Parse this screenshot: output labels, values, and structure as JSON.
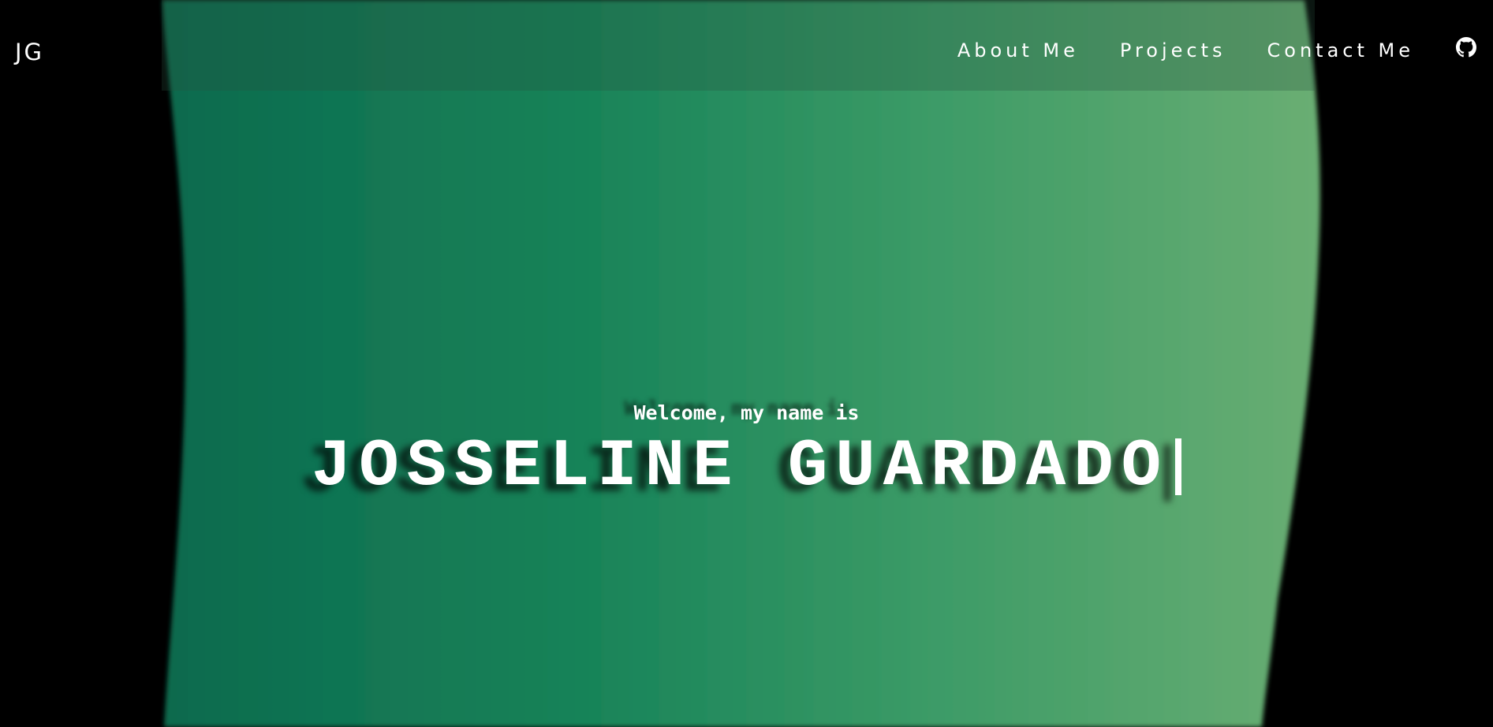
{
  "colors": {
    "background": "#000000",
    "gradient_left": "#0f6e50",
    "gradient_mid": "#1e8a5e",
    "gradient_right": "#64ad72",
    "text": "#ffffff"
  },
  "header": {
    "logo": "JG",
    "nav": [
      {
        "label": "About Me"
      },
      {
        "label": "Projects"
      },
      {
        "label": "Contact Me"
      }
    ],
    "github_icon": "github-icon"
  },
  "hero": {
    "greeting": "Welcome, my name is",
    "name": "JOSSELINE GUARDADO",
    "cursor": "text-cursor"
  }
}
